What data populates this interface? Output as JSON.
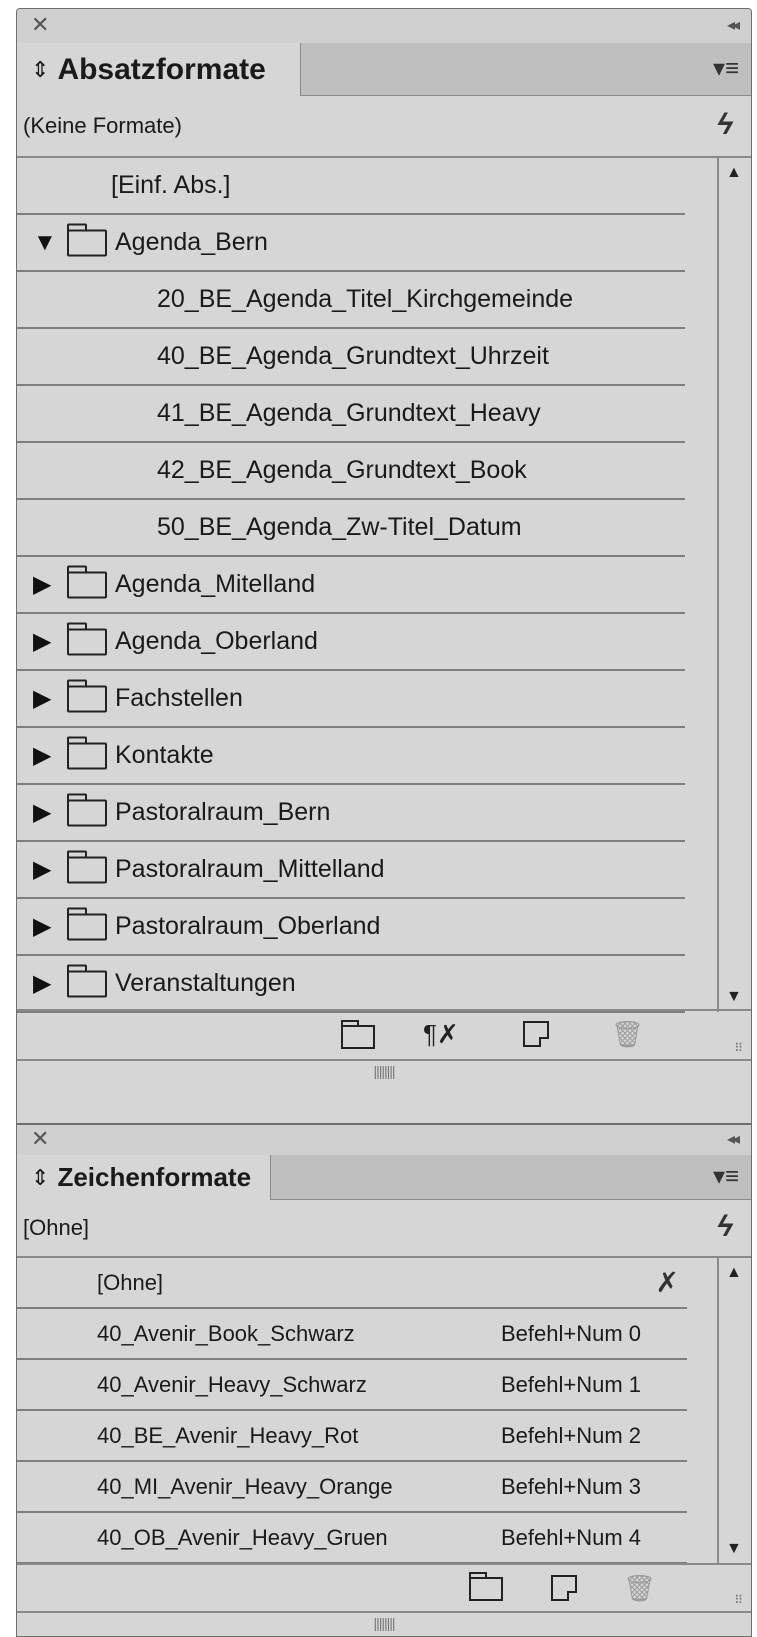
{
  "absatz_panel": {
    "close_glyph": "✕",
    "collapse_glyph": "◂◂",
    "sort_glyph": "⇕",
    "tab_label": "Absatzformate",
    "menu_glyph": "▾≡",
    "current_style": "(Keine Formate)",
    "quick_apply_glyph": "ϟ",
    "items": [
      {
        "label": "[Einf. Abs.]",
        "kind": "style",
        "indent": 0
      },
      {
        "label": "Agenda_Bern",
        "kind": "group",
        "expanded": true
      },
      {
        "label": "20_BE_Agenda_Titel_Kirchgemeinde",
        "kind": "style",
        "indent": 1
      },
      {
        "label": "40_BE_Agenda_Grundtext_Uhrzeit",
        "kind": "style",
        "indent": 1
      },
      {
        "label": "41_BE_Agenda_Grundtext_Heavy",
        "kind": "style",
        "indent": 1
      },
      {
        "label": "42_BE_Agenda_Grundtext_Book",
        "kind": "style",
        "indent": 1
      },
      {
        "label": "50_BE_Agenda_Zw-Titel_Datum",
        "kind": "style",
        "indent": 1
      },
      {
        "label": "Agenda_Mitelland",
        "kind": "group",
        "expanded": false
      },
      {
        "label": "Agenda_Oberland",
        "kind": "group",
        "expanded": false
      },
      {
        "label": "Fachstellen",
        "kind": "group",
        "expanded": false
      },
      {
        "label": "Kontakte",
        "kind": "group",
        "expanded": false
      },
      {
        "label": "Pastoralraum_Bern",
        "kind": "group",
        "expanded": false
      },
      {
        "label": "Pastoralraum_Mittelland",
        "kind": "group",
        "expanded": false
      },
      {
        "label": "Pastoralraum_Oberland",
        "kind": "group",
        "expanded": false
      },
      {
        "label": "Veranstaltungen",
        "kind": "group",
        "expanded": false
      }
    ],
    "clear_overrides_glyph": "¶✗"
  },
  "zeichen_panel": {
    "close_glyph": "✕",
    "collapse_glyph": "◂◂",
    "sort_glyph": "⇕",
    "tab_label": "Zeichenformate",
    "menu_glyph": "▾≡",
    "current_style": "[Ohne]",
    "quick_apply_glyph": "ϟ",
    "items": [
      {
        "label": "[Ohne]",
        "shortcut": "",
        "non_editable": true
      },
      {
        "label": "40_Avenir_Book_Schwarz",
        "shortcut": "Befehl+Num 0"
      },
      {
        "label": "40_Avenir_Heavy_Schwarz",
        "shortcut": "Befehl+Num 1"
      },
      {
        "label": "40_BE_Avenir_Heavy_Rot",
        "shortcut": "Befehl+Num 2"
      },
      {
        "label": "40_MI_Avenir_Heavy_Orange",
        "shortcut": "Befehl+Num 3"
      },
      {
        "label": "40_OB_Avenir_Heavy_Gruen",
        "shortcut": "Befehl+Num 4"
      }
    ]
  },
  "icons": {
    "scroll_up": "▲",
    "scroll_down": "▼",
    "expanded": "▼",
    "collapsed": "▶",
    "trash": "🗑",
    "grip": "⠿",
    "divider_grip": "||||||||"
  }
}
